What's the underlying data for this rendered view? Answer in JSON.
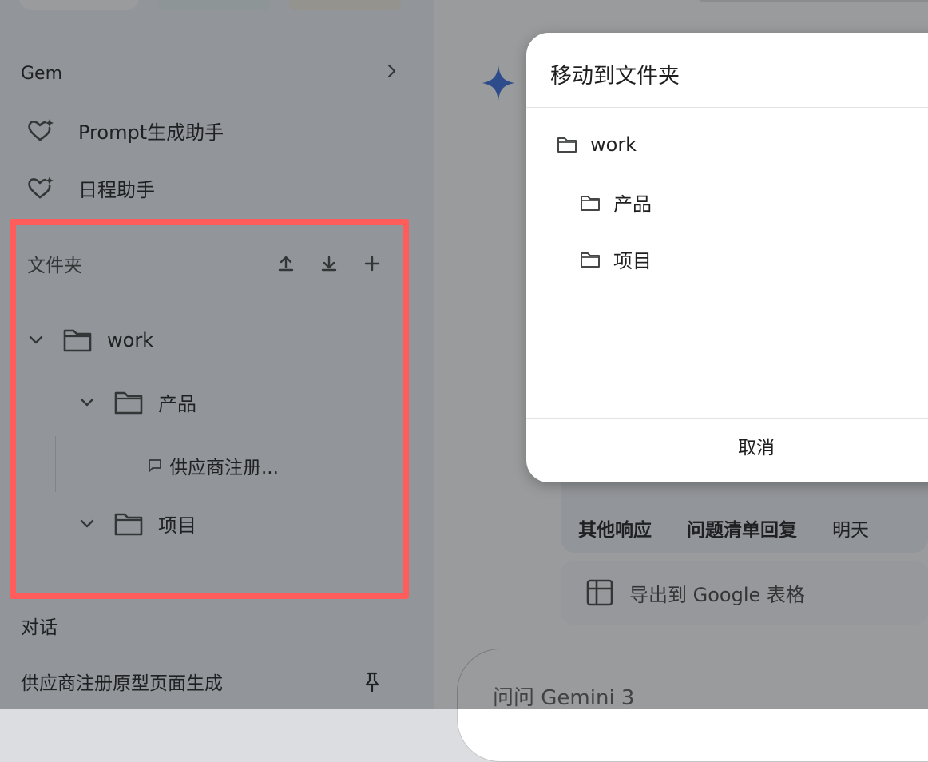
{
  "sidebar": {
    "gem_section": {
      "title": "Gem"
    },
    "gems": [
      {
        "label": "Prompt生成助手"
      },
      {
        "label": "日程助手"
      }
    ],
    "folders": {
      "title": "文件夹",
      "tree": {
        "label": "work",
        "children": [
          {
            "label": "产品",
            "conversations": [
              {
                "label": "供应商注册..."
              }
            ]
          },
          {
            "label": "项目"
          }
        ]
      }
    },
    "conversations": {
      "title": "对话",
      "items": [
        {
          "label": "供应商注册原型页面生成"
        }
      ]
    }
  },
  "main": {
    "table_row": {
      "col1": "其他响应",
      "col2": "问题清单回复",
      "col3": "明天"
    },
    "export_label": "导出到 Google 表格",
    "input_placeholder": "问问 Gemini 3"
  },
  "dialog": {
    "title": "移动到文件夹",
    "folders": [
      {
        "label": "work"
      },
      {
        "label": "产品"
      },
      {
        "label": "项目"
      }
    ],
    "cancel_label": "取消"
  },
  "colors": {
    "highlight_border": "#ff5c5c",
    "gemini_blue": "#3b6fe0",
    "sidebar_bg": "#f0f4f9"
  }
}
